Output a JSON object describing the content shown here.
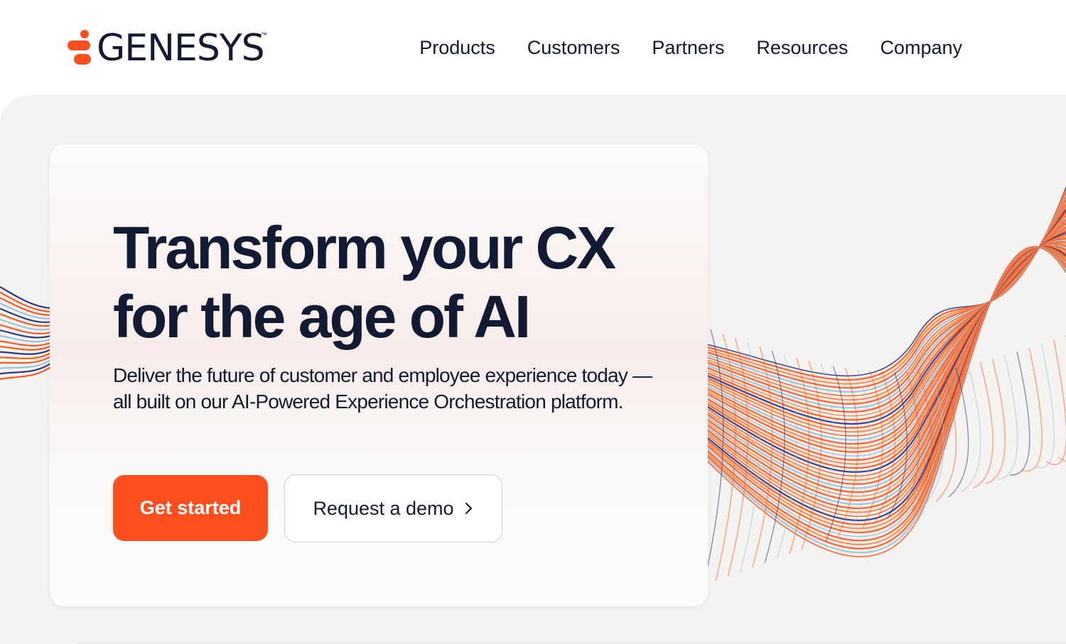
{
  "brand": {
    "name": "GENESYS",
    "trademark": "™",
    "accent_color": "#ff4f1f",
    "text_color": "#141a30"
  },
  "nav": {
    "items": [
      {
        "label": "Products"
      },
      {
        "label": "Customers"
      },
      {
        "label": "Partners"
      },
      {
        "label": "Resources"
      },
      {
        "label": "Company"
      }
    ]
  },
  "hero": {
    "headline_line1": "Transform your CX",
    "headline_line2": "for the age of AI",
    "subheading": "Deliver the future of customer and employee experience today — all built on our AI-Powered Experience Orchestration platform.",
    "primary_cta": "Get started",
    "secondary_cta": "Request a demo",
    "secondary_cta_icon": "chevron-right-icon",
    "background_color": "#f5f3f2",
    "ribbon_colors": [
      "#ff5a1f",
      "#ff8a4a",
      "#9ec3d6",
      "#2b3a7a",
      "#ffffff"
    ]
  }
}
